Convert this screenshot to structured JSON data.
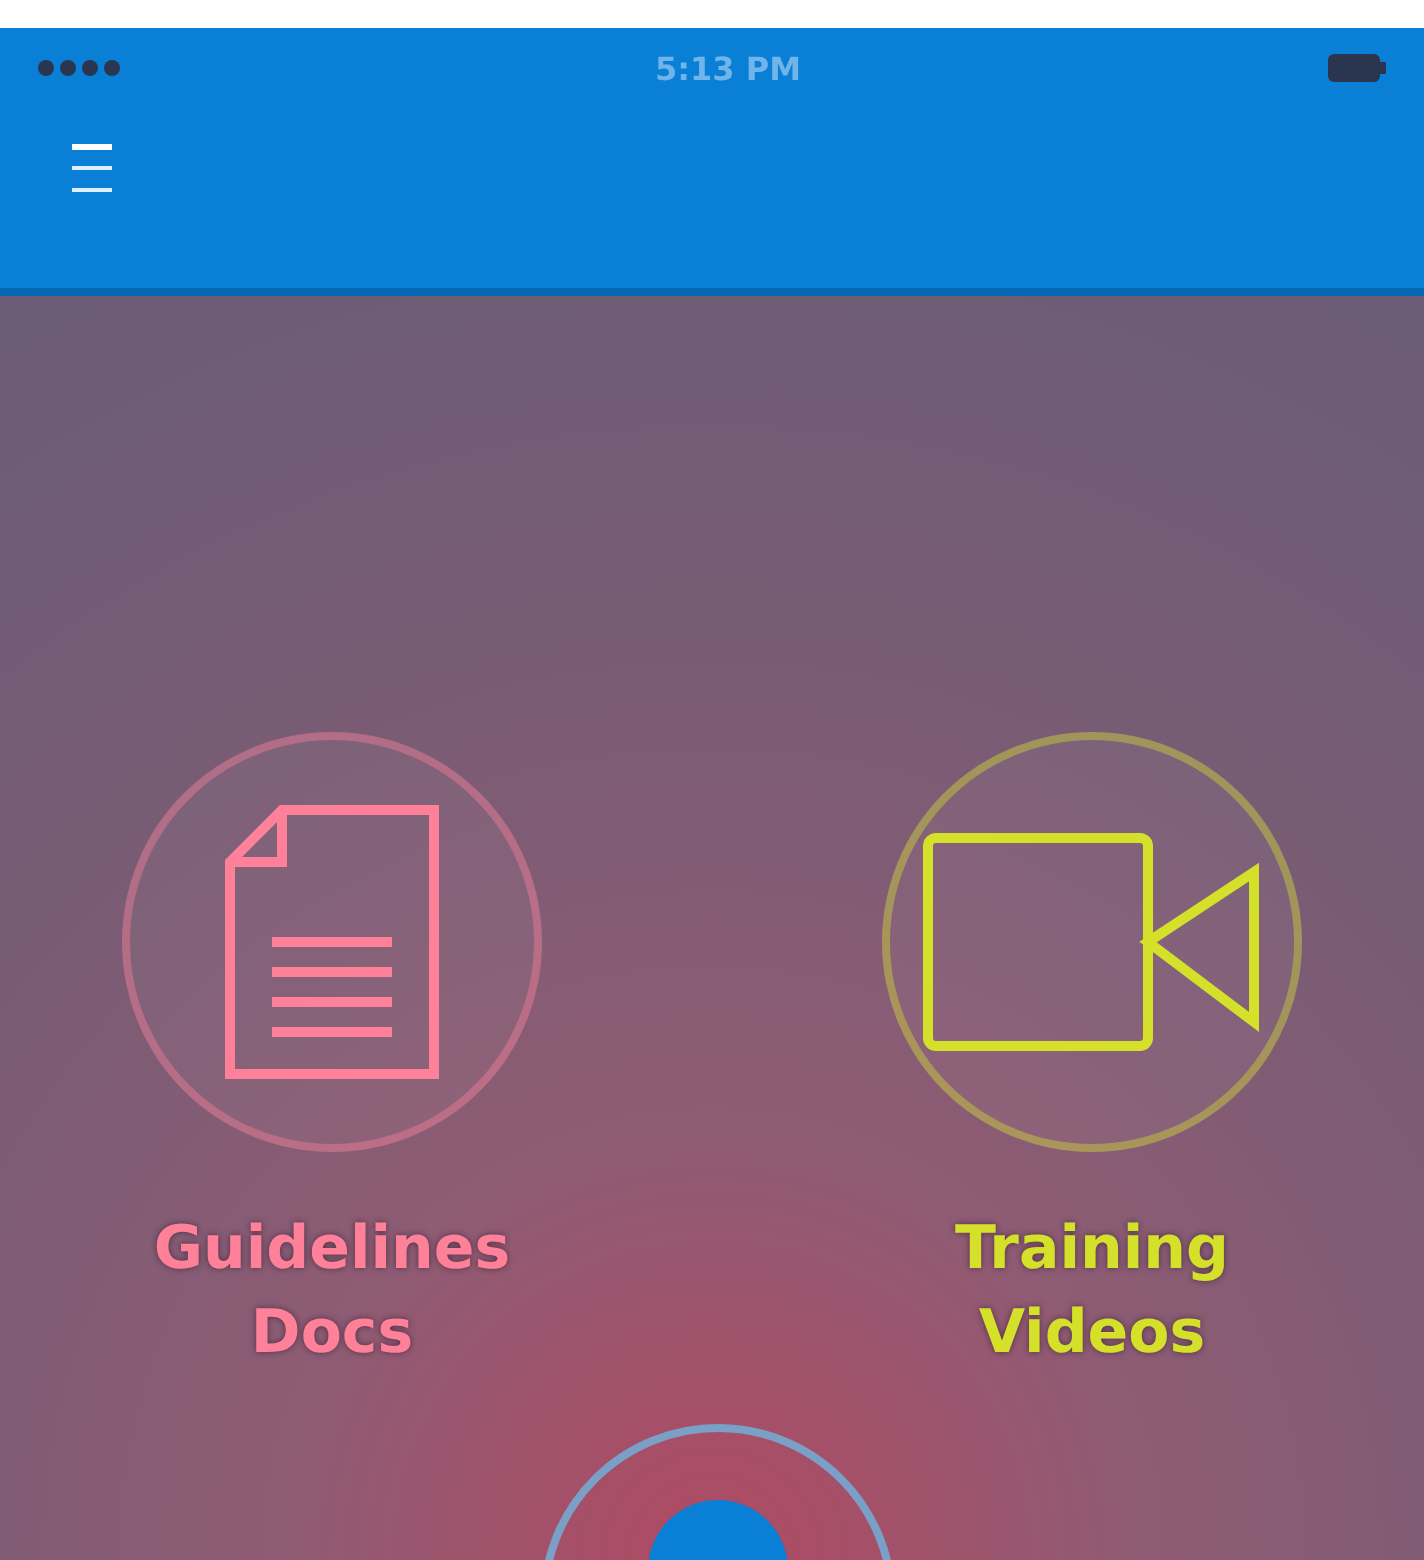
{
  "status_bar": {
    "time": "5:13 PM"
  },
  "tiles": [
    {
      "kind": "document",
      "label": "Guidelines Docs",
      "color": "#ff8099"
    },
    {
      "kind": "video",
      "label": "Training Videos",
      "color": "#d4e02a"
    }
  ]
}
